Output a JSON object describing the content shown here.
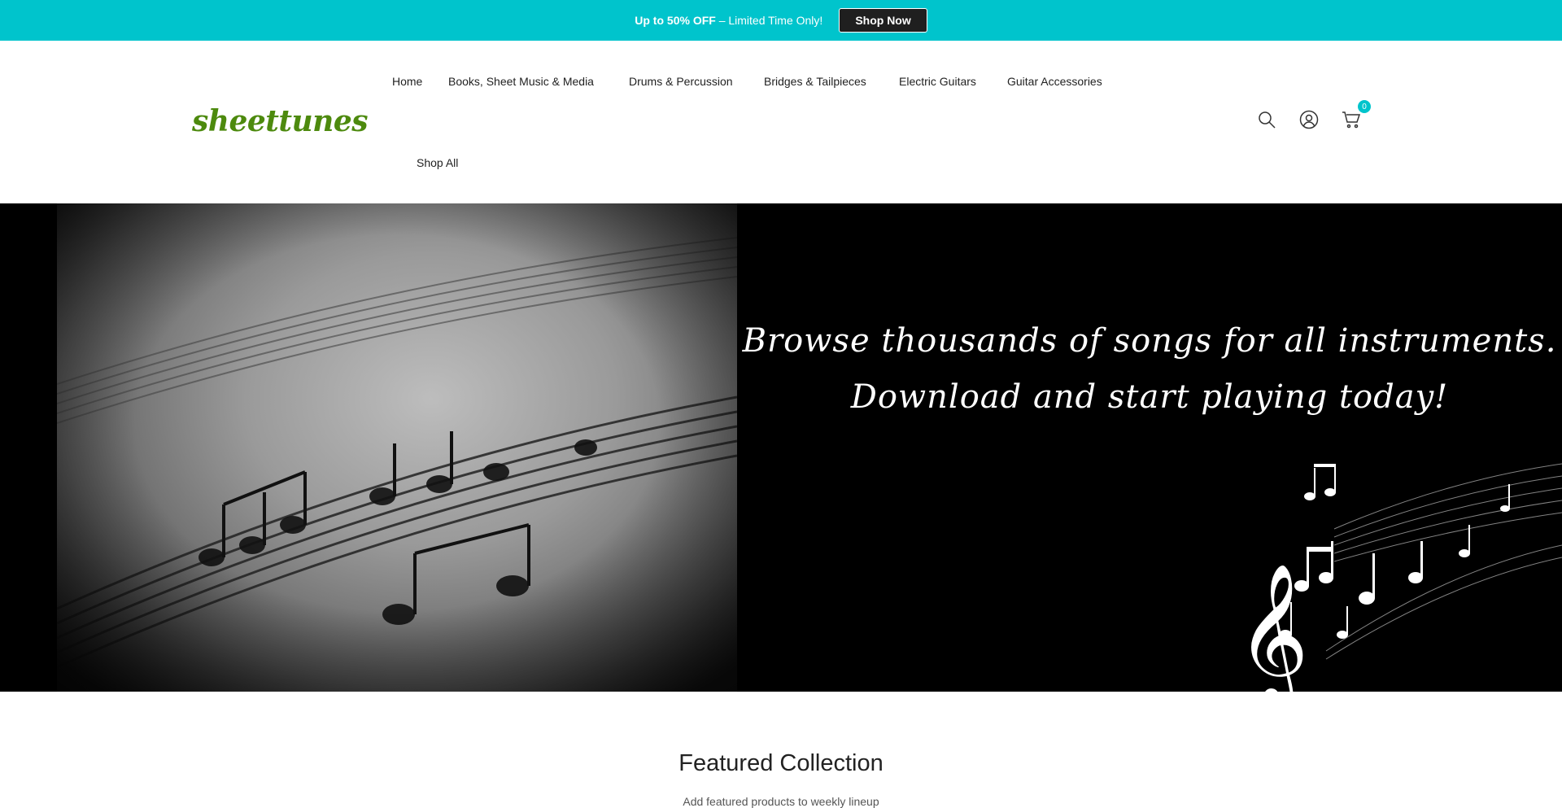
{
  "announcement": {
    "bold_text": "Up to 50% OFF",
    "text": " – Limited Time Only!",
    "button_label": "Shop Now",
    "bg_color": "#00c4cc"
  },
  "header": {
    "logo_text": "sheettunes",
    "logo_color": "#4d8a0e",
    "nav": [
      {
        "label": "Home"
      },
      {
        "label": "Books, Sheet Music & Media"
      },
      {
        "label": "Drums & Percussion"
      },
      {
        "label": "Bridges & Tailpieces"
      },
      {
        "label": "Electric Guitars"
      },
      {
        "label": "Guitar Accessories"
      },
      {
        "label": "Shop All"
      }
    ],
    "icons": [
      "search-icon",
      "account-icon",
      "cart-icon"
    ],
    "cart_count": "0"
  },
  "hero": {
    "line1": "Browse thousands of songs for all instruments.",
    "line2": "Download and start playing today!"
  },
  "featured": {
    "title": "Featured Collection",
    "subtitle": "Add featured products to weekly lineup"
  }
}
